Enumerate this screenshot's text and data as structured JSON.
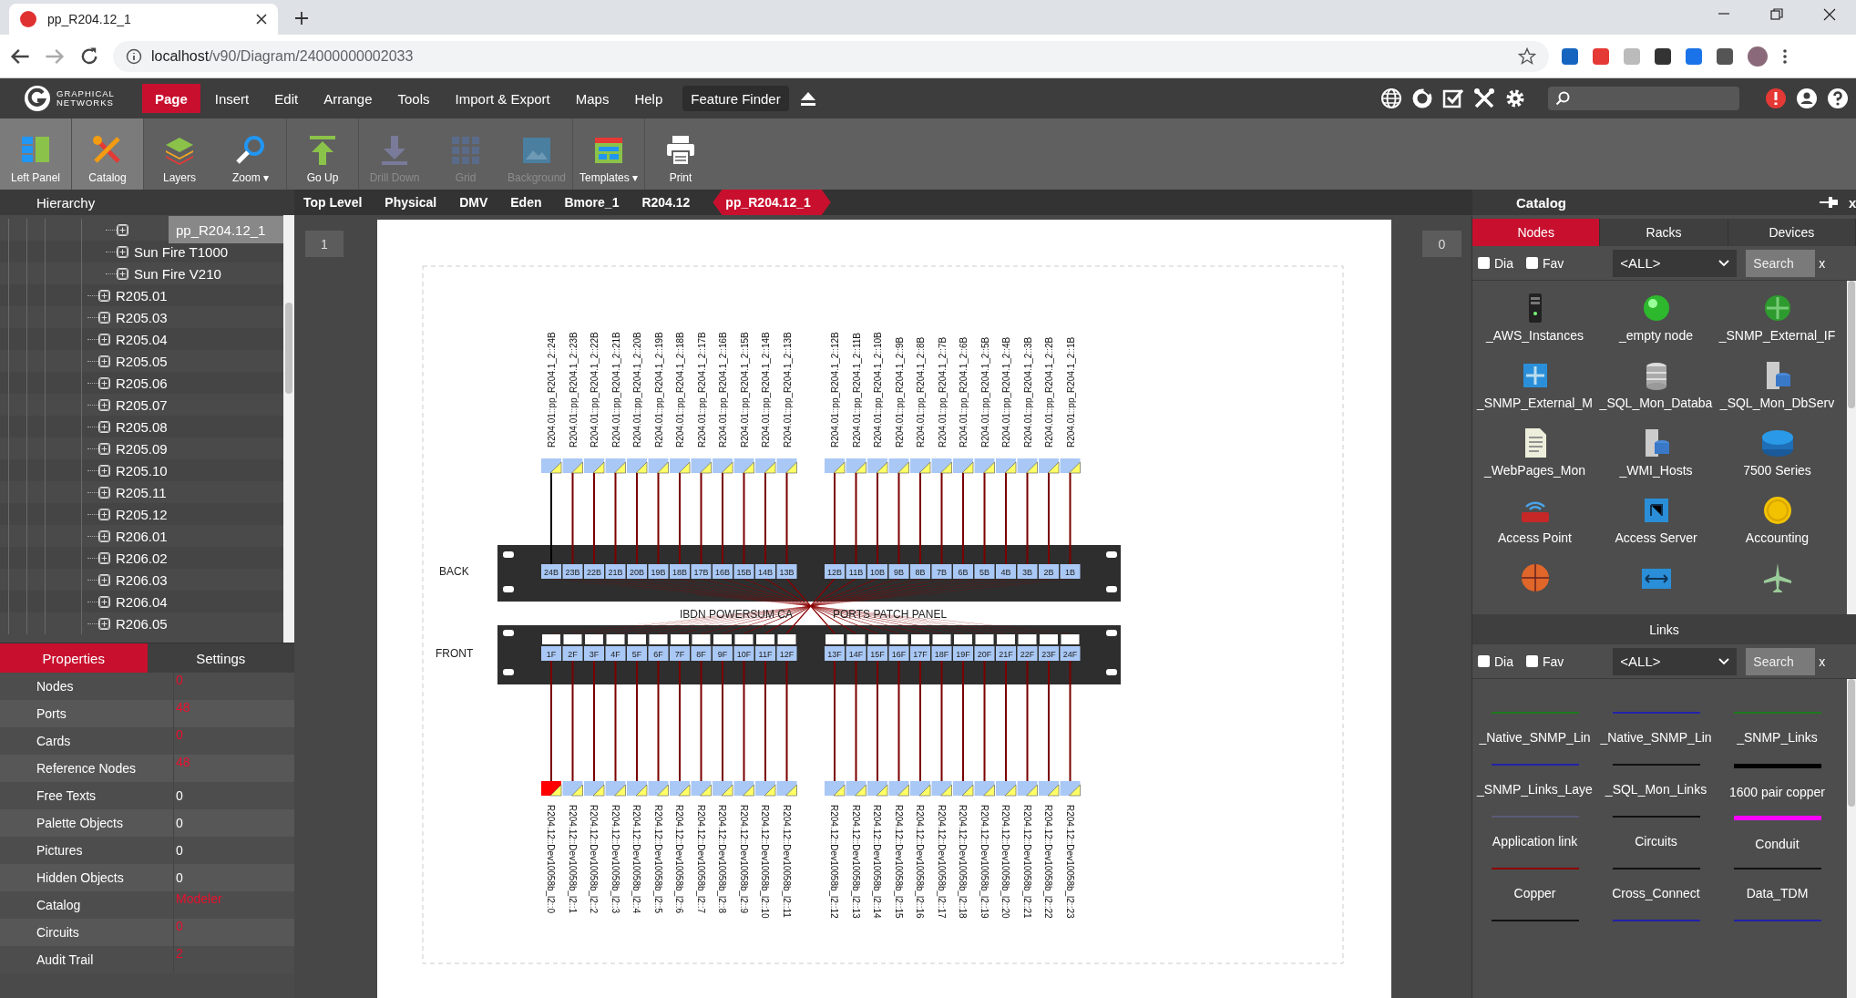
{
  "browser": {
    "tab_title": "pp_R204.12_1",
    "url_host": "localhost",
    "url_path": "/v90/Diagram/24000000002033"
  },
  "app": {
    "logo_top": "GRAPHICAL",
    "logo_bottom": "NETWORKS",
    "menu": [
      {
        "label": "Page",
        "selected": true
      },
      {
        "label": "Insert",
        "selected": false
      },
      {
        "label": "Edit",
        "selected": false
      },
      {
        "label": "Arrange",
        "selected": false
      },
      {
        "label": "Tools",
        "selected": false
      },
      {
        "label": "Import & Export",
        "selected": false
      },
      {
        "label": "Maps",
        "selected": false
      },
      {
        "label": "Help",
        "selected": false
      }
    ],
    "feature_finder": "Feature Finder"
  },
  "toolbar": [
    {
      "label": "Left Panel",
      "active": true,
      "disabled": false
    },
    {
      "label": "Catalog",
      "active": true,
      "disabled": false
    },
    {
      "label": "Layers",
      "active": false,
      "disabled": false
    },
    {
      "label": "Zoom",
      "active": false,
      "disabled": false,
      "caret": "▾"
    },
    {
      "label": "Go Up",
      "active": false,
      "disabled": false
    },
    {
      "label": "Drill Down",
      "active": false,
      "disabled": true
    },
    {
      "label": "Grid",
      "active": false,
      "disabled": true
    },
    {
      "label": "Background",
      "active": false,
      "disabled": true
    },
    {
      "label": "Templates",
      "active": false,
      "disabled": false,
      "caret": "▾"
    },
    {
      "label": "Print",
      "active": false,
      "disabled": false
    }
  ],
  "hierarchy": {
    "title": "Hierarchy",
    "items": [
      {
        "children": [
          {
            "label": "pp_R204.12_1",
            "selected": true
          },
          {
            "label": "Sun Fire T1000",
            "selected": false
          },
          {
            "label": "Sun Fire V210",
            "selected": false
          }
        ]
      },
      {
        "label": "R205.01",
        "selected": false
      },
      {
        "label": "R205.03",
        "selected": false
      },
      {
        "label": "R205.04",
        "selected": false
      },
      {
        "label": "R205.05",
        "selected": false
      },
      {
        "label": "R205.06",
        "selected": false
      },
      {
        "label": "R205.07",
        "selected": false
      },
      {
        "label": "R205.08",
        "selected": false
      },
      {
        "label": "R205.09",
        "selected": false
      },
      {
        "label": "R205.10",
        "selected": false
      },
      {
        "label": "R205.11",
        "selected": false
      },
      {
        "label": "R205.12",
        "selected": false
      },
      {
        "label": "R206.01",
        "selected": false
      },
      {
        "label": "R206.02",
        "selected": false
      },
      {
        "label": "R206.03",
        "selected": false
      },
      {
        "label": "R206.04",
        "selected": false
      },
      {
        "label": "R206.05",
        "selected": false
      }
    ]
  },
  "left_tabs": [
    {
      "label": "Properties",
      "selected": true
    },
    {
      "label": "Settings",
      "selected": false
    }
  ],
  "properties": [
    {
      "name": "Nodes",
      "value": "0",
      "link": true
    },
    {
      "name": "Ports",
      "value": "48",
      "link": true
    },
    {
      "name": "Cards",
      "value": "0",
      "link": true
    },
    {
      "name": "Reference Nodes",
      "value": "48",
      "link": true
    },
    {
      "name": "Free Texts",
      "value": "0",
      "link": false
    },
    {
      "name": "Palette Objects",
      "value": "0",
      "link": false
    },
    {
      "name": "Pictures",
      "value": "0",
      "link": false
    },
    {
      "name": "Hidden Objects",
      "value": "0",
      "link": false
    },
    {
      "name": "Catalog",
      "value": "Modeler",
      "link": true
    },
    {
      "name": "Circuits",
      "value": "0",
      "link": true
    },
    {
      "name": "Audit Trail",
      "value": "2",
      "link": true
    }
  ],
  "breadcrumb": [
    {
      "label": "Top Level",
      "selected": false
    },
    {
      "label": "Physical",
      "selected": false
    },
    {
      "label": "DMV",
      "selected": false
    },
    {
      "label": "Eden",
      "selected": false
    },
    {
      "label": "Bmore_1",
      "selected": false
    },
    {
      "label": "R204.12",
      "selected": false
    },
    {
      "label": "pp_R204.12_1",
      "selected": true
    }
  ],
  "canvas": {
    "page_number": "1",
    "counter": "0"
  },
  "diagram": {
    "top_ports": [
      {
        "label": "R204.01::pp_R204.1_2::24B",
        "color": "#000000"
      },
      {
        "label": "R204.01::pp_R204.1_2::23B",
        "color": "#7a0000"
      },
      {
        "label": "R204.01::pp_R204.1_2::22B",
        "color": "#7a0000"
      },
      {
        "label": "R204.01::pp_R204.1_2::21B",
        "color": "#7a0000"
      },
      {
        "label": "R204.01::pp_R204.1_2::20B",
        "color": "#7a0000"
      },
      {
        "label": "R204.01::pp_R204.1_2::19B",
        "color": "#7a0000"
      },
      {
        "label": "R204.01::pp_R204.1_2::18B",
        "color": "#7a0000"
      },
      {
        "label": "R204.01::pp_R204.1_2::17B",
        "color": "#7a0000"
      },
      {
        "label": "R204.01::pp_R204.1_2::16B",
        "color": "#7a0000"
      },
      {
        "label": "R204.01::pp_R204.1_2::15B",
        "color": "#7a0000"
      },
      {
        "label": "R204.01::pp_R204.1_2::14B",
        "color": "#7a0000"
      },
      {
        "label": "R204.01::pp_R204.1_2::13B",
        "color": "#7a0000"
      },
      {
        "label": "R204.01::pp_R204.1_2::12B",
        "color": "#7a0000"
      },
      {
        "label": "R204.01::pp_R204.1_2::11B",
        "color": "#7a0000"
      },
      {
        "label": "R204.01::pp_R204.1_2::10B",
        "color": "#7a0000"
      },
      {
        "label": "R204.01::pp_R204.1_2::9B",
        "color": "#7a0000"
      },
      {
        "label": "R204.01::pp_R204.1_2::8B",
        "color": "#7a0000"
      },
      {
        "label": "R204.01::pp_R204.1_2::7B",
        "color": "#7a0000"
      },
      {
        "label": "R204.01::pp_R204.1_2::6B",
        "color": "#7a0000"
      },
      {
        "label": "R204.01::pp_R204.1_2::5B",
        "color": "#7a0000"
      },
      {
        "label": "R204.01::pp_R204.1_2::4B",
        "color": "#7a0000"
      },
      {
        "label": "R204.01::pp_R204.1_2::3B",
        "color": "#7a0000"
      },
      {
        "label": "R204.01::pp_R204.1_2::2B",
        "color": "#7a0000"
      },
      {
        "label": "R204.01::pp_R204.1_2::1B",
        "color": "#7a0000"
      }
    ],
    "back": {
      "label": "BACK",
      "ports": [
        "24B",
        "23B",
        "22B",
        "21B",
        "20B",
        "19B",
        "18B",
        "17B",
        "16B",
        "15B",
        "14B",
        "13B",
        "12B",
        "11B",
        "10B",
        "9B",
        "8B",
        "7B",
        "6B",
        "5B",
        "4B",
        "3B",
        "2B",
        "1B"
      ]
    },
    "title_parts": [
      "IBDN POWERSUM CA",
      "PORTS PATCH PANEL"
    ],
    "front": {
      "label": "FRONT",
      "ports": [
        "1F",
        "2F",
        "3F",
        "4F",
        "5F",
        "6F",
        "7F",
        "8F",
        "9F",
        "10F",
        "11F",
        "12F",
        "13F",
        "14F",
        "15F",
        "16F",
        "17F",
        "18F",
        "19F",
        "20F",
        "21F",
        "22F",
        "23F",
        "24F"
      ]
    },
    "bottom_ports": [
      {
        "label": "R204.12::Dev10058b_l2::0",
        "color": "#ff0000"
      },
      {
        "label": "R204.12::Dev10058b_l2::1",
        "color": "#a9c8f5"
      },
      {
        "label": "R204.12::Dev10058b_l2::2",
        "color": "#a9c8f5"
      },
      {
        "label": "R204.12::Dev10058b_l2::3",
        "color": "#a9c8f5"
      },
      {
        "label": "R204.12::Dev10058b_l2::4",
        "color": "#a9c8f5"
      },
      {
        "label": "R204.12::Dev10058b_l2::5",
        "color": "#a9c8f5"
      },
      {
        "label": "R204.12::Dev10058b_l2::6",
        "color": "#a9c8f5"
      },
      {
        "label": "R204.12::Dev10058b_l2::7",
        "color": "#a9c8f5"
      },
      {
        "label": "R204.12::Dev10058b_l2::8",
        "color": "#a9c8f5"
      },
      {
        "label": "R204.12::Dev10058b_l2::9",
        "color": "#a9c8f5"
      },
      {
        "label": "R204.12::Dev10058b_l2::10",
        "color": "#a9c8f5"
      },
      {
        "label": "R204.12::Dev10058b_l2::11",
        "color": "#a9c8f5"
      },
      {
        "label": "R204.12::Dev10058b_l2::12",
        "color": "#a9c8f5"
      },
      {
        "label": "R204.12::Dev10058b_l2::13",
        "color": "#a9c8f5"
      },
      {
        "label": "R204.12::Dev10058b_l2::14",
        "color": "#a9c8f5"
      },
      {
        "label": "R204.12::Dev10058b_l2::15",
        "color": "#a9c8f5"
      },
      {
        "label": "R204.12::Dev10058b_l2::16",
        "color": "#a9c8f5"
      },
      {
        "label": "R204.12::Dev10058b_l2::17",
        "color": "#a9c8f5"
      },
      {
        "label": "R204.12::Dev10058b_l2::18",
        "color": "#a9c8f5"
      },
      {
        "label": "R204.12::Dev10058b_l2::19",
        "color": "#a9c8f5"
      },
      {
        "label": "R204.12::Dev10058b_l2::20",
        "color": "#a9c8f5"
      },
      {
        "label": "R204.12::Dev10058b_l2::21",
        "color": "#a9c8f5"
      },
      {
        "label": "R204.12::Dev10058b_l2::22",
        "color": "#a9c8f5"
      },
      {
        "label": "R204.12::Dev10058b_l2::23",
        "color": "#a9c8f5"
      }
    ]
  },
  "catalog": {
    "title": "Catalog",
    "close": "x",
    "tabs": [
      {
        "label": "Nodes",
        "selected": true
      },
      {
        "label": "Racks",
        "selected": false
      },
      {
        "label": "Devices",
        "selected": false
      }
    ],
    "node_filter": {
      "dia": {
        "label": "Dia",
        "checked": false
      },
      "fav": {
        "label": "Fav",
        "checked": false
      },
      "select": "<ALL>",
      "search_placeholder": "Search",
      "clear": "x"
    },
    "nodes": [
      {
        "kind": "full",
        "label": "_AWS_Instances"
      },
      {
        "kind": "full",
        "label": "_empty node"
      },
      {
        "kind": "full",
        "label": "_SNMP_External_IF"
      },
      {
        "kind": "full",
        "label": "_SNMP_External_M"
      },
      {
        "kind": "full",
        "label": "_SQL_Mon_Databa"
      },
      {
        "kind": "full",
        "label": "_SQL_Mon_DbServ"
      },
      {
        "kind": "full",
        "label": "_WebPages_Mon"
      },
      {
        "kind": "full",
        "label": "_WMI_Hosts"
      },
      {
        "kind": "full",
        "label": "7500 Series"
      },
      {
        "kind": "full",
        "label": "Access Point"
      },
      {
        "kind": "full",
        "label": "Access Server"
      },
      {
        "kind": "full",
        "label": "Accounting"
      },
      {
        "kind": "cut"
      },
      {
        "kind": "cut"
      },
      {
        "kind": "cut"
      }
    ],
    "links_title": "Links",
    "link_filter": {
      "dia": {
        "label": "Dia",
        "checked": false
      },
      "fav": {
        "label": "Fav",
        "checked": false
      },
      "select": "<ALL>",
      "search_placeholder": "Search",
      "clear": "x"
    },
    "links": [
      {
        "label": "_Native_SNMP_Lin",
        "color": "#1d7a1d",
        "thick": false
      },
      {
        "label": "_Native_SNMP_Lin",
        "color": "#2222aa",
        "thick": false
      },
      {
        "label": "_SNMP_Links",
        "color": "#1d7a1d",
        "thick": false
      },
      {
        "label": "_SNMP_Links_Laye",
        "color": "#2222aa",
        "thick": false
      },
      {
        "label": "_SQL_Mon_Links",
        "color": "#111111",
        "thick": false
      },
      {
        "label": "1600 pair copper",
        "color": "#000000",
        "thick": true
      },
      {
        "label": "Application link",
        "color": "#5a5a78",
        "thick": false
      },
      {
        "label": "Circuits",
        "color": "#111111",
        "thick": false
      },
      {
        "label": "Conduit",
        "color": "#ff00ff",
        "thick": true
      },
      {
        "label": "Copper",
        "color": "#8b0000",
        "thick": false
      },
      {
        "label": "Cross_Connect",
        "color": "#111111",
        "thick": false
      },
      {
        "label": "Data_TDM",
        "color": "#111111",
        "thick": false
      },
      {
        "color": "#111111",
        "thick": false
      },
      {
        "color": "#2222aa",
        "thick": false
      },
      {
        "color": "#2222aa",
        "thick": false
      }
    ]
  }
}
